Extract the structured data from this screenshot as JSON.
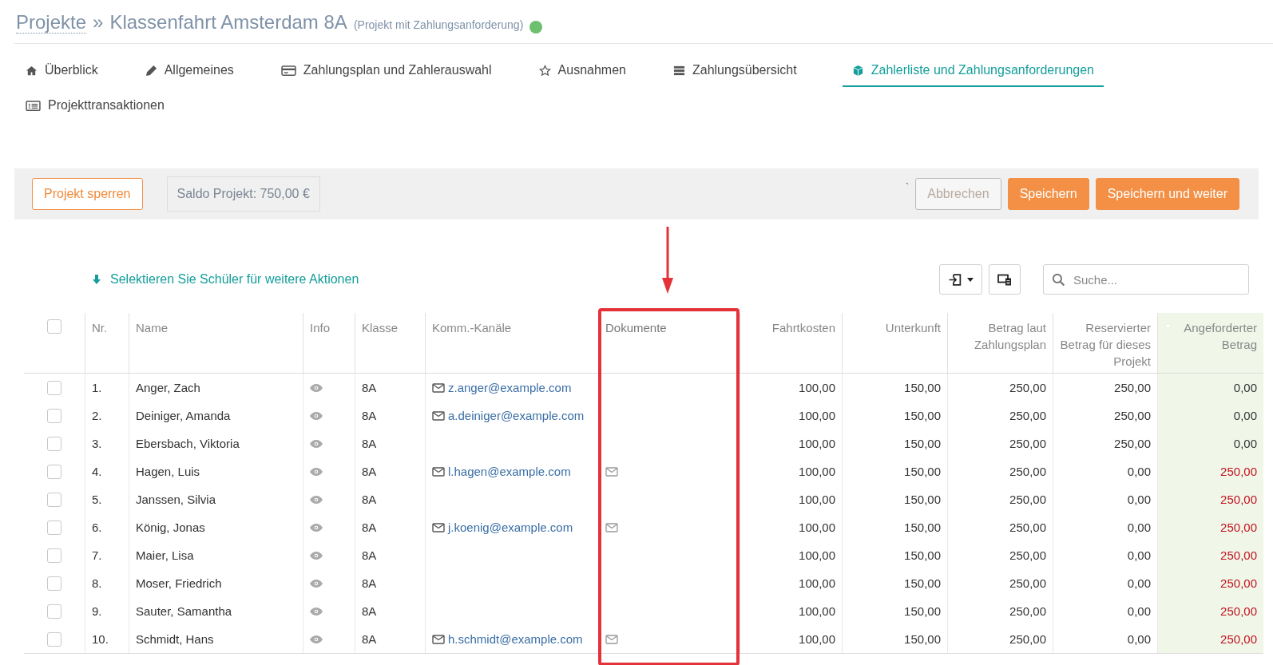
{
  "breadcrumb": {
    "link": "Projekte",
    "separator": "»",
    "title": "Klassenfahrt Amsterdam 8A",
    "subtitle": "(Projekt mit Zahlungsanforderung)"
  },
  "tabs": [
    {
      "label": "Überblick",
      "kind": "home",
      "selected": false
    },
    {
      "label": "Allgemeines",
      "kind": "pencil",
      "selected": false
    },
    {
      "label": "Zahlungsplan und Zahlerauswahl",
      "kind": "card",
      "selected": false
    },
    {
      "label": "Ausnahmen",
      "kind": "star",
      "selected": false
    },
    {
      "label": "Zahlungsübersicht",
      "kind": "stack",
      "selected": false
    },
    {
      "label": "Zahlerliste und Zahlungsanforderungen",
      "kind": "cube",
      "selected": true
    },
    {
      "label": "Projekttransaktionen",
      "kind": "list",
      "selected": false
    }
  ],
  "toolbar": {
    "lock_button": "Projekt sperren",
    "balance": "Saldo Projekt: 750,00 €",
    "stray_mark": "`",
    "cancel_button": "Abbrechen",
    "save_button": "Speichern",
    "save_continue_button": "Speichern und weiter"
  },
  "selection_hint": "Selektieren Sie Schüler für weitere Aktionen",
  "search": {
    "placeholder": "Suche..."
  },
  "table": {
    "all_checked": false,
    "columns": [
      {
        "label": "Nr.",
        "kind": "text",
        "highlighted": false,
        "filter": false
      },
      {
        "label": "Name",
        "kind": "text",
        "highlighted": false,
        "filter": false
      },
      {
        "label": "Info",
        "kind": "text",
        "highlighted": false,
        "filter": false
      },
      {
        "label": "Klasse",
        "kind": "text",
        "highlighted": false,
        "filter": false
      },
      {
        "label": "Komm.-Kanäle",
        "kind": "text",
        "highlighted": false,
        "filter": false
      },
      {
        "label": "Dokumente",
        "kind": "text",
        "highlighted": true,
        "filter": false
      },
      {
        "label": "Fahrtkosten",
        "kind": "number",
        "highlighted": false,
        "filter": false
      },
      {
        "label": "Unterkunft",
        "kind": "number",
        "highlighted": false,
        "filter": false
      },
      {
        "label": "Betrag laut Zahlungsplan",
        "kind": "number",
        "highlighted": false,
        "filter": false
      },
      {
        "label": "Reservierter Betrag für dieses Projekt",
        "kind": "number",
        "highlighted": false,
        "filter": false
      },
      {
        "label": "Angeforderter Betrag",
        "kind": "number",
        "highlighted": false,
        "filter": true
      }
    ],
    "rows": [
      {
        "checked": false,
        "nr": "1.",
        "name": "Anger, Zach",
        "klasse": "8A",
        "email": "z.anger@example.com",
        "document": false,
        "fahrtkosten": "100,00",
        "unterkunft": "150,00",
        "plan": "250,00",
        "reserviert": "250,00",
        "angefordert": "0,00",
        "outstanding": false
      },
      {
        "checked": false,
        "nr": "2.",
        "name": "Deiniger, Amanda",
        "klasse": "8A",
        "email": "a.deiniger@example.com",
        "document": false,
        "fahrtkosten": "100,00",
        "unterkunft": "150,00",
        "plan": "250,00",
        "reserviert": "250,00",
        "angefordert": "0,00",
        "outstanding": false
      },
      {
        "checked": false,
        "nr": "3.",
        "name": "Ebersbach, Viktoria",
        "klasse": "8A",
        "document": false,
        "fahrtkosten": "100,00",
        "unterkunft": "150,00",
        "plan": "250,00",
        "reserviert": "250,00",
        "angefordert": "0,00",
        "outstanding": false
      },
      {
        "checked": false,
        "nr": "4.",
        "name": "Hagen, Luis",
        "klasse": "8A",
        "email": "l.hagen@example.com",
        "document": true,
        "fahrtkosten": "100,00",
        "unterkunft": "150,00",
        "plan": "250,00",
        "reserviert": "0,00",
        "angefordert": "250,00",
        "outstanding": true
      },
      {
        "checked": false,
        "nr": "5.",
        "name": "Janssen, Silvia",
        "klasse": "8A",
        "document": false,
        "fahrtkosten": "100,00",
        "unterkunft": "150,00",
        "plan": "250,00",
        "reserviert": "0,00",
        "angefordert": "250,00",
        "outstanding": true
      },
      {
        "checked": false,
        "nr": "6.",
        "name": "König, Jonas",
        "klasse": "8A",
        "email": "j.koenig@example.com",
        "document": true,
        "fahrtkosten": "100,00",
        "unterkunft": "150,00",
        "plan": "250,00",
        "reserviert": "0,00",
        "angefordert": "250,00",
        "outstanding": true
      },
      {
        "checked": false,
        "nr": "7.",
        "name": "Maier, Lisa",
        "klasse": "8A",
        "document": false,
        "fahrtkosten": "100,00",
        "unterkunft": "150,00",
        "plan": "250,00",
        "reserviert": "0,00",
        "angefordert": "250,00",
        "outstanding": true
      },
      {
        "checked": false,
        "nr": "8.",
        "name": "Moser, Friedrich",
        "klasse": "8A",
        "document": false,
        "fahrtkosten": "100,00",
        "unterkunft": "150,00",
        "plan": "250,00",
        "reserviert": "0,00",
        "angefordert": "250,00",
        "outstanding": true
      },
      {
        "checked": false,
        "nr": "9.",
        "name": "Sauter, Samantha",
        "klasse": "8A",
        "document": false,
        "fahrtkosten": "100,00",
        "unterkunft": "150,00",
        "plan": "250,00",
        "reserviert": "0,00",
        "angefordert": "250,00",
        "outstanding": true
      },
      {
        "checked": false,
        "nr": "10.",
        "name": "Schmidt, Hans",
        "klasse": "8A",
        "email": "h.schmidt@example.com",
        "document": true,
        "fahrtkosten": "100,00",
        "unterkunft": "150,00",
        "plan": "250,00",
        "reserviert": "0,00",
        "angefordert": "250,00",
        "outstanding": true
      }
    ]
  }
}
